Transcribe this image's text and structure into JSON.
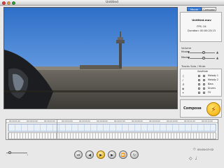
{
  "window": {
    "title": "Untitled"
  },
  "video": {
    "frame": "video-preview"
  },
  "panel": {
    "tabs": [
      "Movie",
      "Compose"
    ],
    "active_tab": 0,
    "info": {
      "filename": "Untitled.mov",
      "fps": "FPS: 24",
      "duration": "Duration: 00:00:23:13"
    },
    "volume_label": "Volume",
    "volume": {
      "music_label": "Music:",
      "movie_label": "Movie:",
      "music_level": 0.55,
      "movie_level": 0.55
    },
    "tracks_header": "Tracks Solo / Mute",
    "track_cols": [
      "Solo",
      "Mute"
    ],
    "tracks": [
      {
        "name": "Melody 1",
        "icon": "instrument-icon"
      },
      {
        "name": "Melody 2",
        "icon": "instrument-icon"
      },
      {
        "name": "Bass",
        "icon": "bass-icon"
      },
      {
        "name": "Drums",
        "icon": "drums-icon"
      },
      {
        "name": "FX",
        "icon": "fx-icon"
      }
    ],
    "compose_label": "Compose"
  },
  "timeline": {
    "ticks": [
      "00:00:01:00",
      "00:00:02:00",
      "00:00:03:00",
      "00:00:04:00",
      "00:00:05:00",
      "00:00:06:00",
      "00:00:07:00",
      "00:00:08:00",
      "00:00:09:00",
      "00:00:10:00",
      "00:00:11:00",
      "00:00:12:00"
    ]
  },
  "transport": {
    "buttons": [
      "rewind-start-icon",
      "step-back-icon",
      "play-icon",
      "step-forward-icon",
      "fast-forward-icon",
      "loop-icon"
    ]
  },
  "timecode": "00:00:07:02"
}
